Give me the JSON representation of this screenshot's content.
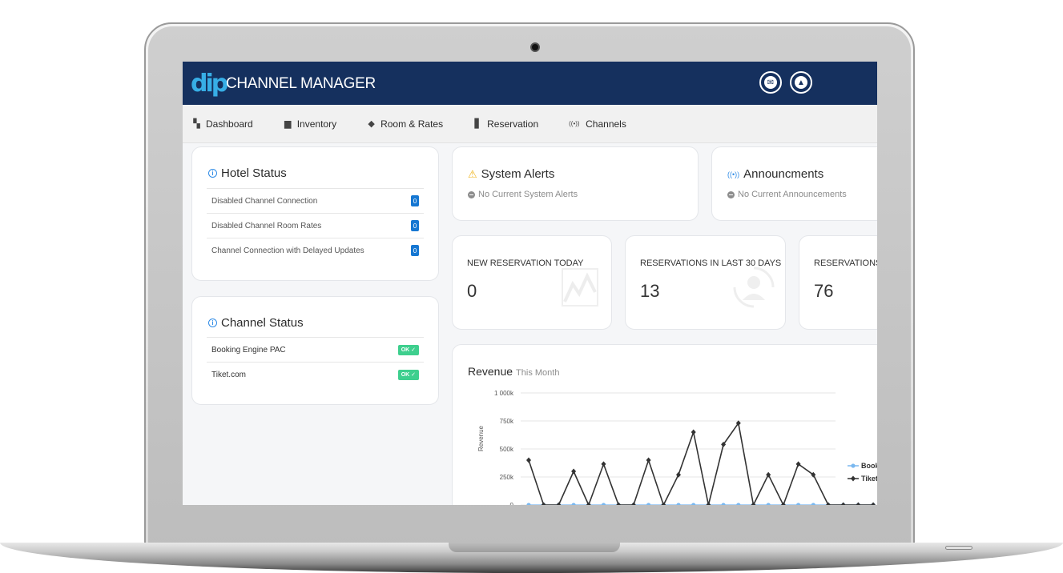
{
  "app": {
    "brand_mark": "dip",
    "title": "CHANNEL MANAGER"
  },
  "nav": [
    {
      "label": "Dashboard",
      "icon": "dashboard-icon"
    },
    {
      "label": "Inventory",
      "icon": "inventory-icon"
    },
    {
      "label": "Room & Rates",
      "icon": "layers-icon"
    },
    {
      "label": "Reservation",
      "icon": "book-icon"
    },
    {
      "label": "Channels",
      "icon": "broadcast-icon"
    }
  ],
  "hotel_status": {
    "title": "Hotel Status",
    "rows": [
      {
        "label": "Disabled Channel Connection",
        "count": "0"
      },
      {
        "label": "Disabled Channel Room Rates",
        "count": "0"
      },
      {
        "label": "Channel Connection with Delayed Updates",
        "count": "0"
      }
    ]
  },
  "channel_status": {
    "title": "Channel Status",
    "rows": [
      {
        "label": "Booking Engine PAC",
        "status": "OK ✓"
      },
      {
        "label": "Tiket.com",
        "status": "OK ✓"
      }
    ]
  },
  "alerts": {
    "title": "System Alerts",
    "message": "No Current System Alerts"
  },
  "announcements": {
    "title": "Announcments",
    "message": "No Current Announcements"
  },
  "stats": [
    {
      "label": "NEW RESERVATION TODAY",
      "value": "0"
    },
    {
      "label": "RESERVATIONS IN LAST 30 DAYS",
      "value": "13"
    },
    {
      "label": "RESERVATIONS I",
      "value": "76"
    }
  ],
  "colors": {
    "header": "#15305e",
    "accent": "#37aee6",
    "ok": "#3ecf8e",
    "badge": "#1677d2",
    "series_booking": "#7ab8f0",
    "series_tiket": "#333333"
  },
  "chart_data": {
    "type": "line",
    "title": "Revenue",
    "subtitle": "This Month",
    "ylabel": "Revenue",
    "xlabel": "",
    "ylim": [
      0,
      1000000
    ],
    "yticks": [
      "0",
      "250k",
      "500k",
      "750k",
      "1 000k"
    ],
    "ytick_values": [
      0,
      250000,
      500000,
      750000,
      1000000
    ],
    "grid": true,
    "legend_position": "right",
    "x": [
      1,
      2,
      3,
      4,
      5,
      6,
      7,
      8,
      9,
      10,
      11,
      12,
      13,
      14,
      15,
      16,
      17,
      18,
      19,
      20,
      21,
      22,
      23,
      24
    ],
    "series": [
      {
        "name": "Book",
        "color": "#7ab8f0",
        "marker": "circle",
        "values": [
          0,
          0,
          0,
          0,
          0,
          0,
          0,
          0,
          0,
          0,
          0,
          0,
          0,
          0,
          0,
          0,
          0,
          0,
          0,
          0,
          0,
          0,
          0,
          0
        ]
      },
      {
        "name": "Tiket",
        "color": "#333333",
        "marker": "diamond",
        "values": [
          400000,
          0,
          0,
          300000,
          0,
          365000,
          0,
          0,
          400000,
          0,
          270000,
          650000,
          0,
          540000,
          730000,
          0,
          270000,
          0,
          365000,
          270000,
          0,
          0,
          0,
          0
        ]
      }
    ]
  }
}
